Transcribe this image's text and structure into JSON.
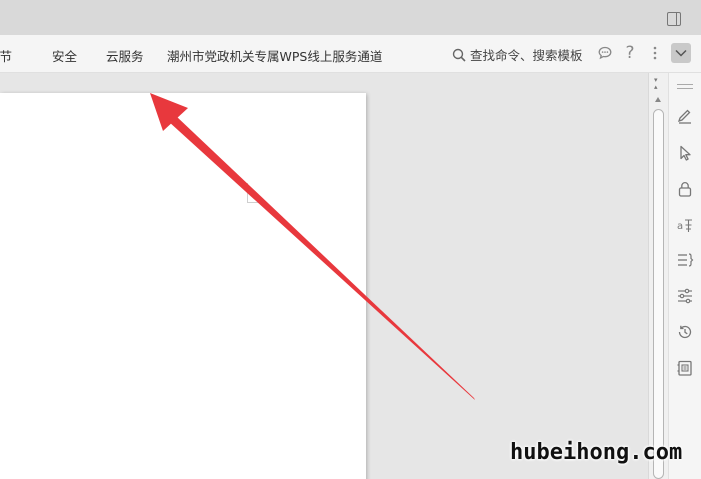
{
  "menubar": {
    "items": [
      "章节",
      "安全",
      "云服务",
      "潮州市党政机关专属WPS线上服务通道"
    ],
    "search_label": "查找命令、搜索模板"
  },
  "icons": {
    "feedback": "chat-bubble-icon",
    "help": "question-mark-icon",
    "more": "more-vertical-icon",
    "collapse": "chevron-down-icon",
    "side_panel": [
      "pen-icon",
      "cursor-select-icon",
      "lock-icon",
      "translate-icon",
      "outline-list-icon",
      "adjust-sliders-icon",
      "history-icon",
      "document-backup-icon"
    ]
  },
  "annotation": {
    "arrow_color": "#e8383d"
  },
  "watermark": "hubeihong.com"
}
